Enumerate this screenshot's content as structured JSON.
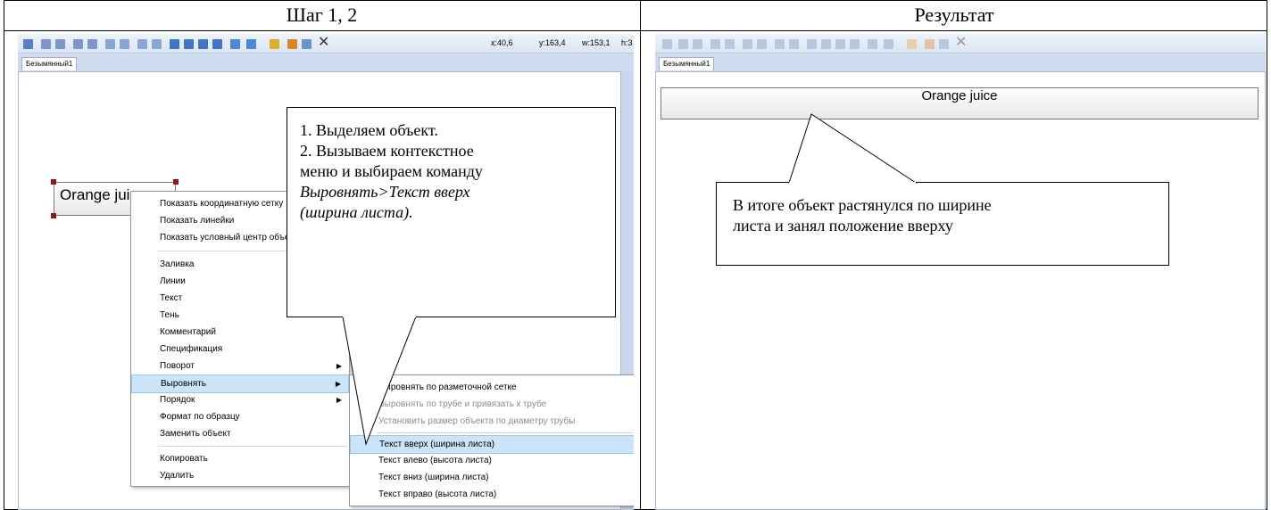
{
  "headers": {
    "left": "Шаг 1, 2",
    "right": "Результат"
  },
  "left_panel": {
    "coords": {
      "x": "x:40,6",
      "y": "y:163,4",
      "w": "w:153,1",
      "h": "h:3"
    },
    "tab_label": "Безымянный1",
    "object_label": "Orange juice",
    "context_menu": [
      {
        "label": "Показать координатную сетку"
      },
      {
        "label": "Показать линейки"
      },
      {
        "label": "Показать условный центр объекта"
      },
      {
        "label": "Заливка"
      },
      {
        "label": "Линии"
      },
      {
        "label": "Текст"
      },
      {
        "label": "Тень"
      },
      {
        "label": "Комментарий"
      },
      {
        "label": "Спецификация"
      },
      {
        "label": "Поворот",
        "submenu": true
      },
      {
        "label": "Выровнять",
        "submenu": true,
        "highlighted": true
      },
      {
        "label": "Порядок",
        "submenu": true
      },
      {
        "label": "Формат по образцу"
      },
      {
        "label": "Заменить объект"
      },
      {
        "label": "Копировать"
      },
      {
        "label": "Удалить"
      }
    ],
    "submenu": [
      {
        "label": "Выровнять по разметочной сетке"
      },
      {
        "label": "Выровнять по трубе и привязать к трубе",
        "disabled": true
      },
      {
        "label": "Установить размер объекта по диаметру трубы",
        "disabled": true
      },
      {
        "label": "Текст вверх (ширина листа)",
        "highlighted": true
      },
      {
        "label": "Текст влево (высота листа)"
      },
      {
        "label": "Текст вниз (ширина листа)"
      },
      {
        "label": "Текст вправо (высота листа)"
      }
    ],
    "callout": {
      "line1": "1. Выделяем объект.",
      "line2": "2. Вызываем контекстное",
      "line3": "меню и выбираем команду",
      "line4": "Выровнять>Текст вверх",
      "line5": "(ширина листа)."
    }
  },
  "right_panel": {
    "tab_label": "Безымянный1",
    "object_label": "Orange juice",
    "callout": {
      "line1": "В итоге объект растянулся по ширине",
      "line2": "листа и занял положение вверху"
    }
  },
  "colors": {
    "highlight": "#cce4f7",
    "toolbar": "#dbe5f3",
    "handle": "#8b1a1a"
  }
}
